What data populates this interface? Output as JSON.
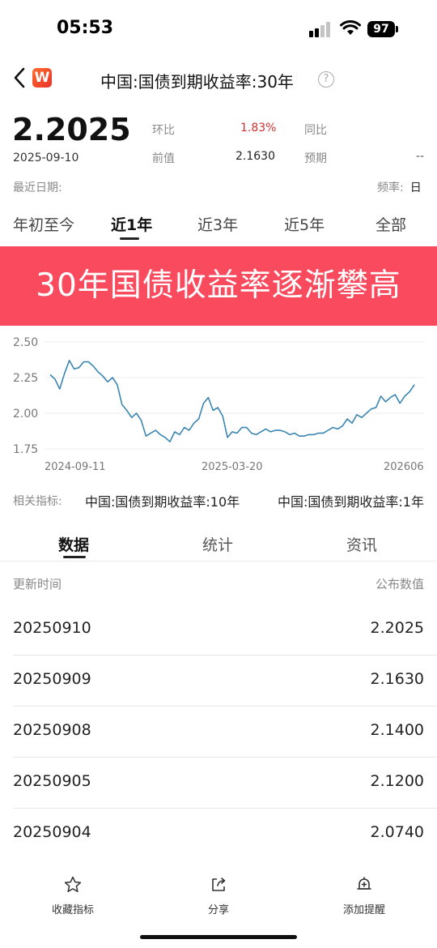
{
  "status_bar": {
    "time": "05:53",
    "battery": "97"
  },
  "header": {
    "logo_text": "W",
    "title": "中国:国债到期收益率:30年",
    "help": "?"
  },
  "summary": {
    "value": "2.2025",
    "date": "2025-09-10",
    "mom_label": "环比",
    "mom_value": "1.83%",
    "yoy_label": "同比",
    "yoy_value": "",
    "prev_label": "前值",
    "prev_value": "2.1630",
    "forecast_label": "预期",
    "forecast_value": "--",
    "recent_date_label": "最近日期:",
    "frequency_label": "频率:",
    "frequency_value": "日"
  },
  "period_tabs": [
    "年初至今",
    "近1年",
    "近3年",
    "近5年",
    "全部"
  ],
  "active_period": "近1年",
  "banner": {
    "text": "30年国债收益率逐渐攀高",
    "color": "#fa4a5e"
  },
  "chart_data": {
    "type": "line",
    "ylim": [
      1.75,
      2.5
    ],
    "yticks": [
      "2.50",
      "2.25",
      "2.00",
      "1.75"
    ],
    "xticks": [
      "2024-09-11",
      "2025-03-20",
      "202606"
    ],
    "grid": true,
    "color": "#3a86b0",
    "series": [
      {
        "x": [
          0,
          6,
          12,
          18,
          24,
          30,
          36,
          42,
          48,
          54,
          60,
          66,
          72,
          78,
          84,
          90,
          96,
          102,
          108,
          114,
          120,
          126,
          132,
          138,
          144,
          150,
          156,
          162,
          168,
          174,
          180,
          186,
          192,
          198,
          204,
          210,
          216,
          222,
          228,
          234,
          240,
          246,
          252,
          258,
          264,
          270,
          276,
          282,
          288,
          294,
          300,
          306,
          312,
          318,
          324,
          330,
          336,
          342,
          348,
          354,
          360,
          366,
          372,
          378,
          384,
          390,
          396,
          402,
          408,
          414,
          420,
          426,
          432,
          438,
          444,
          450,
          456
        ],
        "values": [
          2.27,
          2.24,
          2.17,
          2.28,
          2.37,
          2.31,
          2.32,
          2.36,
          2.36,
          2.33,
          2.29,
          2.26,
          2.22,
          2.25,
          2.2,
          2.06,
          2.02,
          1.97,
          2.0,
          1.95,
          1.84,
          1.86,
          1.88,
          1.85,
          1.83,
          1.8,
          1.87,
          1.85,
          1.9,
          1.88,
          1.93,
          1.96,
          2.07,
          2.11,
          2.02,
          2.04,
          1.98,
          1.83,
          1.87,
          1.86,
          1.9,
          1.9,
          1.86,
          1.85,
          1.87,
          1.89,
          1.87,
          1.88,
          1.88,
          1.87,
          1.85,
          1.86,
          1.84,
          1.84,
          1.85,
          1.85,
          1.86,
          1.86,
          1.88,
          1.9,
          1.89,
          1.91,
          1.96,
          1.93,
          1.99,
          1.97,
          2.0,
          2.03,
          2.04,
          2.12,
          2.08,
          2.11,
          2.13,
          2.07,
          2.12,
          2.15,
          2.2
        ]
      }
    ]
  },
  "related": {
    "label": "相关指标:",
    "items": [
      "中国:国债到期收益率:10年",
      "中国:国债到期收益率:1年"
    ]
  },
  "data_tabs": [
    "数据",
    "统计",
    "资讯"
  ],
  "active_data_tab": "数据",
  "table": {
    "headers": [
      "更新时间",
      "公布数值"
    ],
    "rows": [
      {
        "date": "20250910",
        "value": "2.2025"
      },
      {
        "date": "20250909",
        "value": "2.1630"
      },
      {
        "date": "20250908",
        "value": "2.1400"
      },
      {
        "date": "20250905",
        "value": "2.1200"
      },
      {
        "date": "20250904",
        "value": "2.0740"
      }
    ]
  },
  "bottom_bar": [
    {
      "icon": "star-icon",
      "label": "收藏指标"
    },
    {
      "icon": "share-icon",
      "label": "分享"
    },
    {
      "icon": "alarm-plus-icon",
      "label": "添加提醒"
    }
  ]
}
